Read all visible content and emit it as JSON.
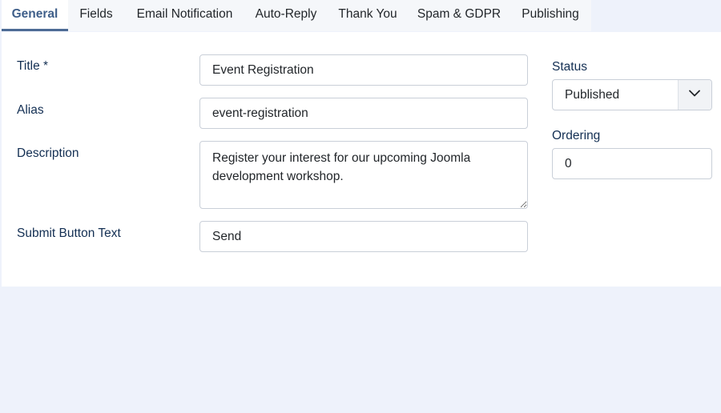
{
  "tabs": [
    {
      "label": "General",
      "active": true
    },
    {
      "label": "Fields",
      "active": false
    },
    {
      "label": "Email Notification",
      "active": false
    },
    {
      "label": "Auto-Reply",
      "active": false
    },
    {
      "label": "Thank You",
      "active": false
    },
    {
      "label": "Spam & GDPR",
      "active": false
    },
    {
      "label": "Publishing",
      "active": false
    }
  ],
  "form": {
    "title_label": "Title *",
    "title_value": "Event Registration",
    "alias_label": "Alias",
    "alias_value": "event-registration",
    "description_label": "Description",
    "description_value": "Register your interest for our upcoming Joomla development workshop.",
    "submit_label": "Submit Button Text",
    "submit_value": "Send"
  },
  "sidebar": {
    "status_label": "Status",
    "status_value": "Published",
    "ordering_label": "Ordering",
    "ordering_value": "0"
  },
  "icons": {
    "dropdown": "chevron-down-icon"
  },
  "colors": {
    "accent": "#4d6b95",
    "label_text": "#132f53",
    "page_background": "#eef2fb"
  }
}
